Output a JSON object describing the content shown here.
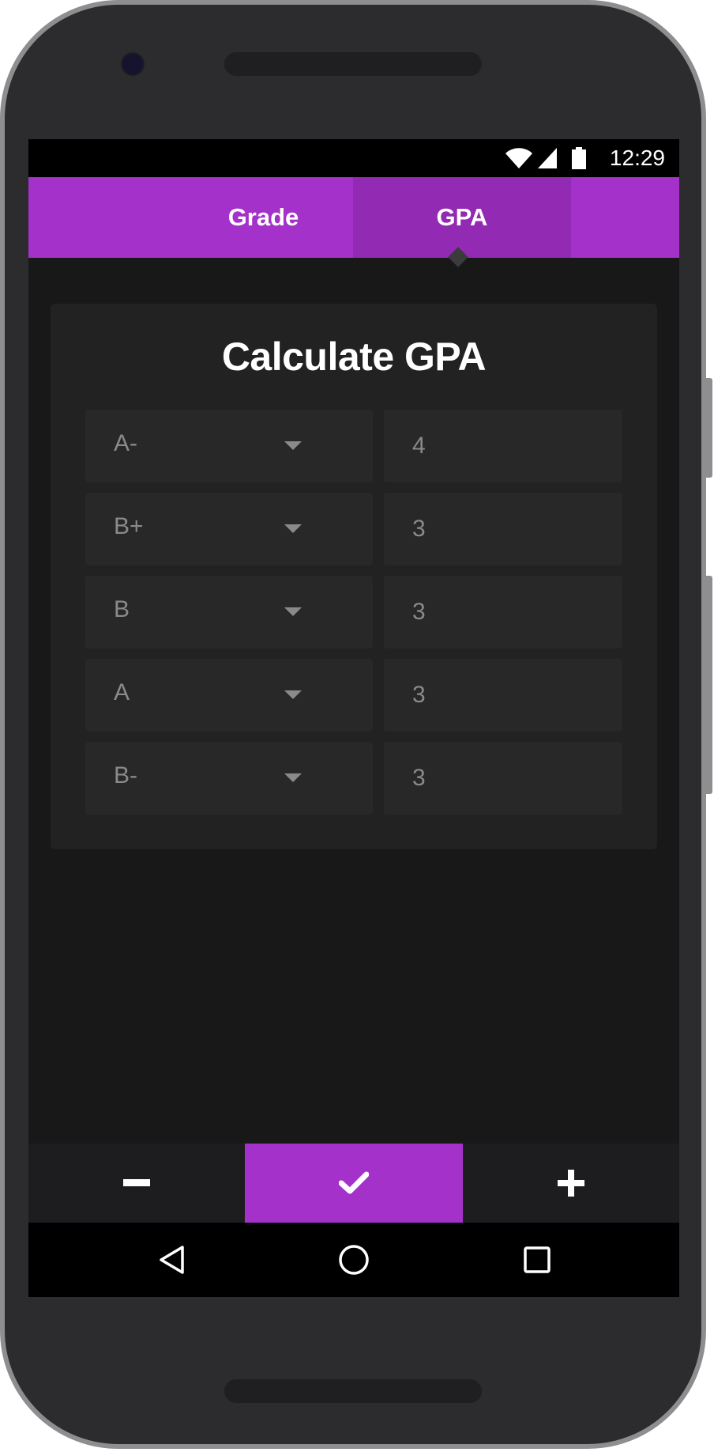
{
  "status_bar": {
    "time": "12:29",
    "icons": [
      "wifi-icon",
      "cell-signal-icon",
      "battery-icon"
    ]
  },
  "tabs": [
    {
      "label": "Grade",
      "selected": false
    },
    {
      "label": "GPA",
      "selected": true
    }
  ],
  "card": {
    "title": "Calculate GPA",
    "rows": [
      {
        "grade": "A-",
        "credits": "4"
      },
      {
        "grade": "B+",
        "credits": "3"
      },
      {
        "grade": "B",
        "credits": "3"
      },
      {
        "grade": "A",
        "credits": "3"
      },
      {
        "grade": "B-",
        "credits": "3"
      }
    ]
  },
  "action_bar": {
    "buttons": [
      "minus-icon",
      "check-icon",
      "plus-icon"
    ]
  },
  "nav_bar": {
    "buttons": [
      "back-icon",
      "home-icon",
      "recents-icon"
    ]
  },
  "colors": {
    "accent": "#a431c9",
    "accent_selected_tab": "#922ab4",
    "background": "#181818",
    "card": "#222222",
    "field": "#282828",
    "muted_text": "#8a8a8a"
  }
}
